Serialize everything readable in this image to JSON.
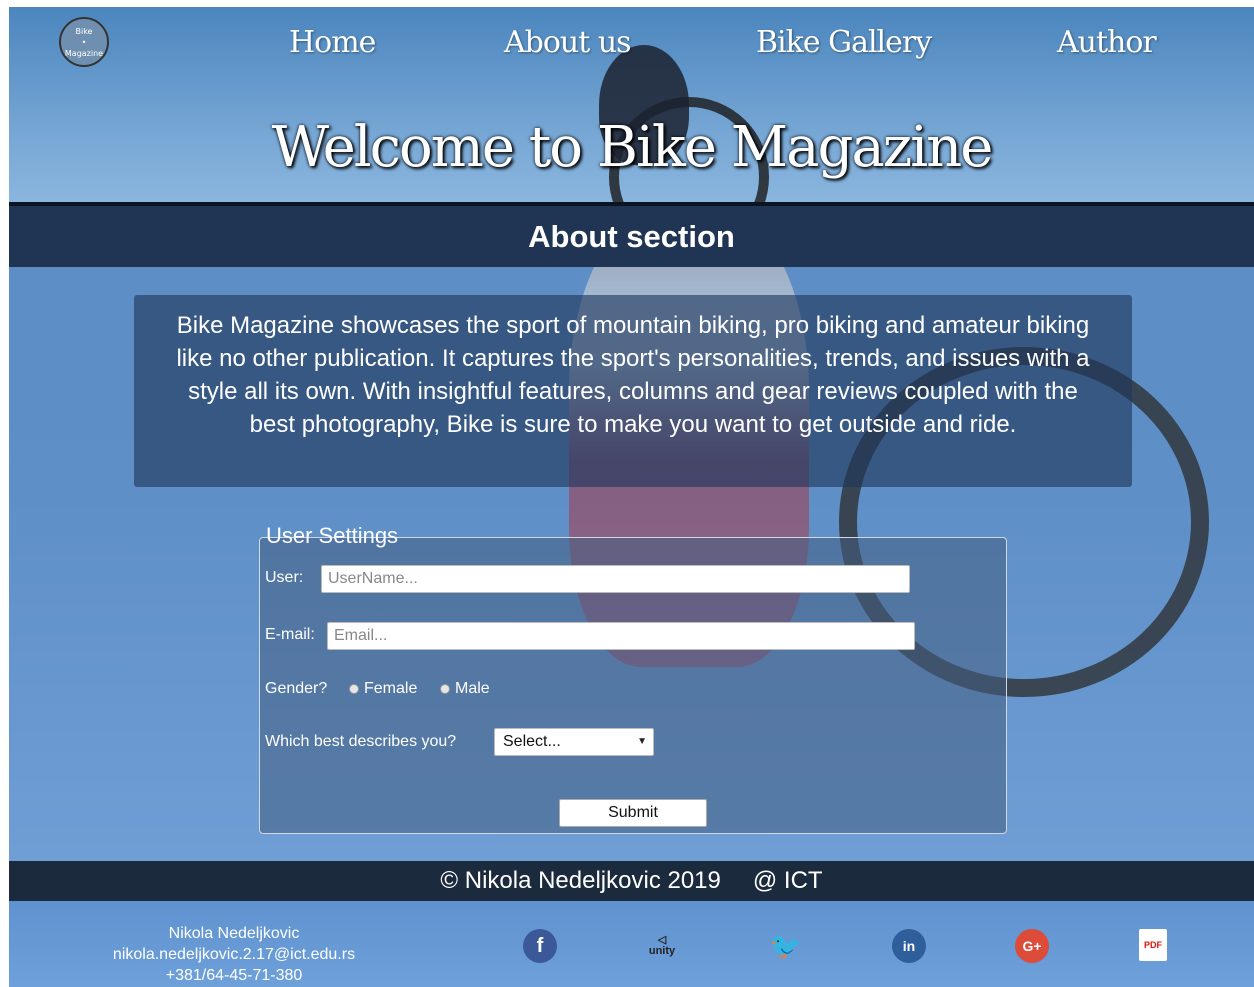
{
  "header": {
    "logo_line1": "Bike",
    "logo_line2": "Magazine",
    "nav": [
      "Home",
      "About us",
      "Bike Gallery",
      "Author"
    ],
    "title": "Welcome to Bike Magazine"
  },
  "section": {
    "title": "About section",
    "text": "Bike Magazine showcases the sport of mountain biking, pro biking and amateur biking like no other publication. It captures the sport's personalities, trends, and issues with a style all its own. With insightful features, columns and gear reviews coupled with the best photography, Bike is sure to make you want to get outside and ride."
  },
  "form": {
    "legend": "User Settings",
    "user_label": "User:",
    "user_placeholder": "UserName...",
    "email_label": "E-mail:",
    "email_placeholder": "Email...",
    "gender_label": "Gender?",
    "gender_options": [
      "Female",
      "Male"
    ],
    "describe_label": "Which best describes you?",
    "select_value": "Select...",
    "submit_label": "Submit"
  },
  "footer": {
    "copyright": "© Nikola Nedeljkovic 2019",
    "org": "@ ICT",
    "contact_name": "Nikola Nedeljkovic",
    "contact_email": "nikola.nedeljkovic.2.17@ict.edu.rs",
    "contact_phone": "+381/64-45-71-380",
    "social": [
      {
        "name": "facebook-icon",
        "glyph": "f",
        "color": "#3b5998"
      },
      {
        "name": "unity-icon",
        "glyph": "unity",
        "color": "#5b8fcf"
      },
      {
        "name": "twitter-icon",
        "glyph": "🐦",
        "color": "#1da1f2"
      },
      {
        "name": "linkedin-icon",
        "glyph": "in",
        "color": "#2f5f9a"
      },
      {
        "name": "google-plus-icon",
        "glyph": "G+",
        "color": "#dd4b39"
      },
      {
        "name": "pdf-icon",
        "glyph": "PDF",
        "color": "#ffffff"
      }
    ]
  },
  "colors": {
    "section_bar": "#1f3553",
    "footer_bar": "#1c2a3d",
    "sky": "#5f8fc7"
  }
}
